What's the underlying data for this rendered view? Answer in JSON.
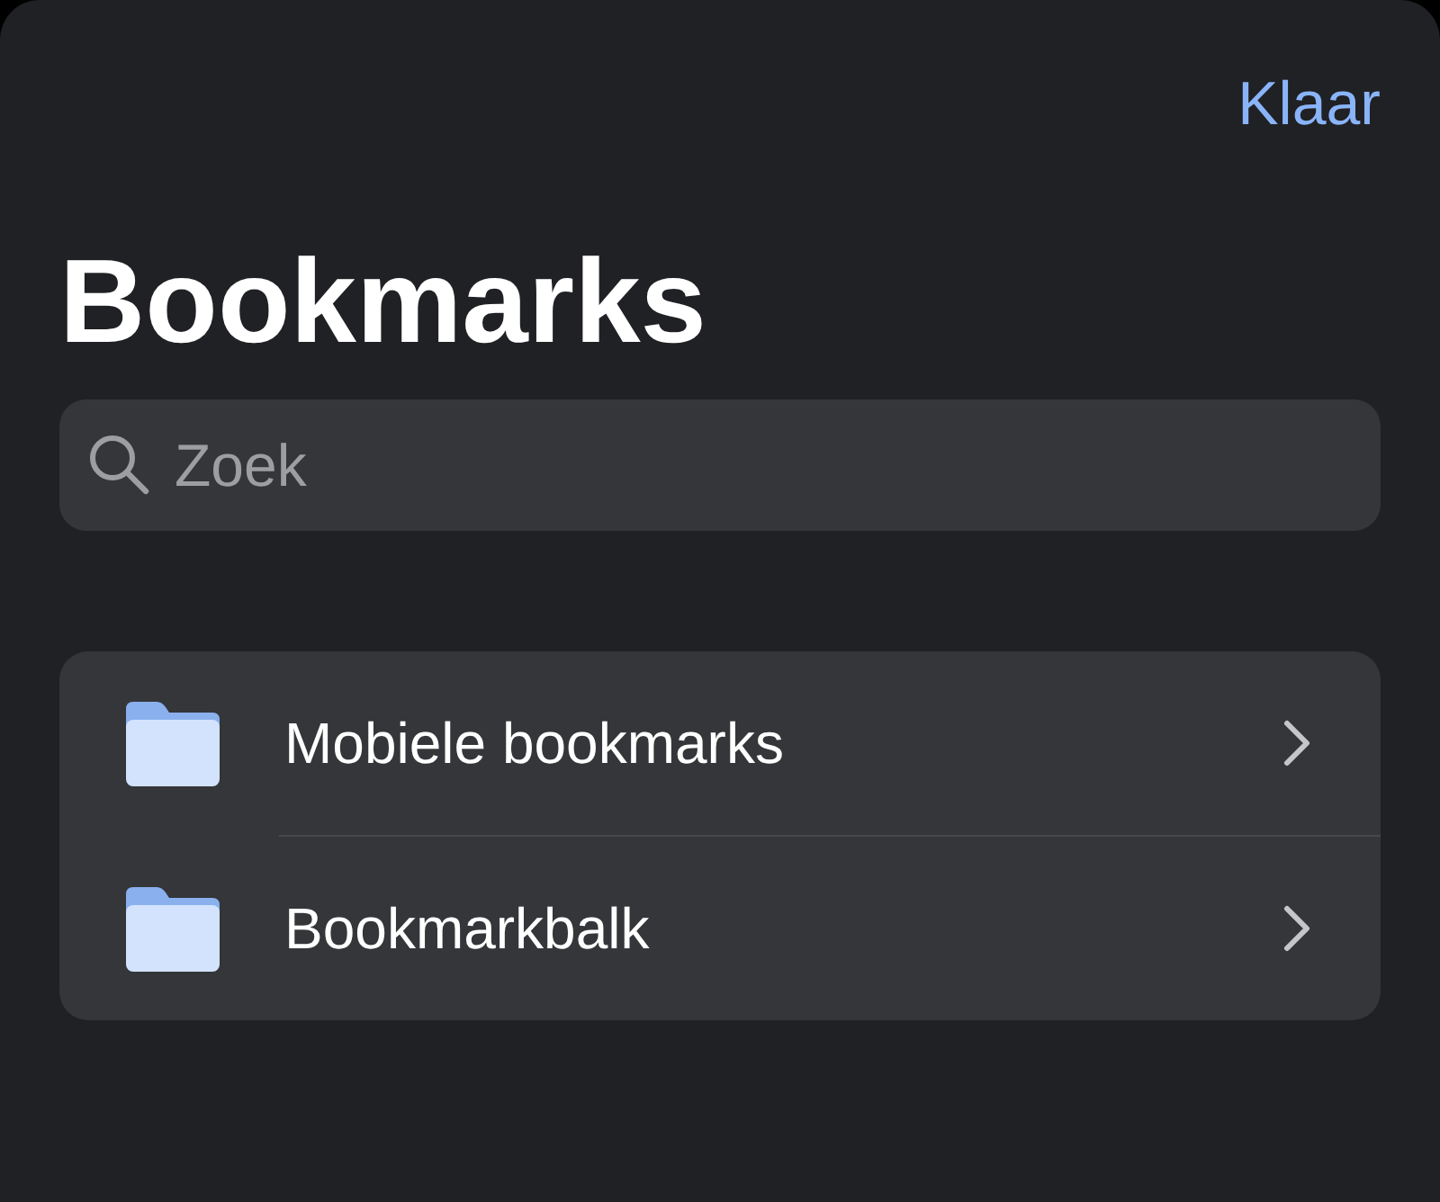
{
  "header": {
    "done_button": "Klaar",
    "title": "Bookmarks"
  },
  "search": {
    "placeholder": "Zoek"
  },
  "folders": [
    {
      "label": "Mobiele bookmarks"
    },
    {
      "label": "Bookmarkbalk"
    }
  ]
}
